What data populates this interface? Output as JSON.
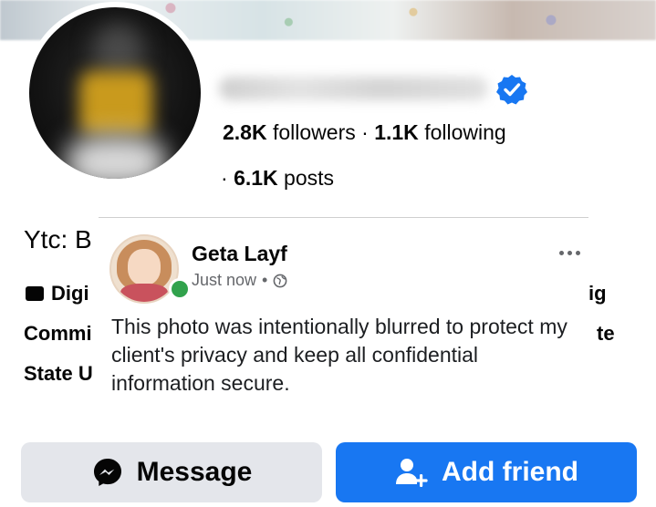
{
  "profile": {
    "stats_followers_count": "2.8K",
    "stats_followers_label": "followers",
    "stats_sep": "·",
    "stats_following_count": "1.1K",
    "stats_following_label": "following",
    "stats_posts_sep": "·",
    "stats_posts_count": "6.1K",
    "stats_posts_label": "posts",
    "verified_icon": "verified-badge-icon"
  },
  "bio": {
    "name_fragment": "Ytc: B",
    "line1_left": "Digi",
    "line1_right": "ig",
    "line2_left": "Commi",
    "line2_right": "te",
    "line3_left": "State U",
    "line1_icon": "card-icon"
  },
  "post": {
    "author": "Geta Layf",
    "time": "Just now",
    "meta_sep": "•",
    "visibility_icon": "globe-icon",
    "body": "This photo was intentionally blurred to protect my client's privacy and keep all confidential information secure."
  },
  "actions": {
    "message_label": "Message",
    "message_icon": "messenger-icon",
    "add_friend_label": "Add friend",
    "add_friend_icon": "add-friend-icon"
  },
  "colors": {
    "accent": "#1877f2",
    "secondary_button": "#e4e6eb",
    "online": "#31a24c",
    "meta_text": "#65676b"
  }
}
